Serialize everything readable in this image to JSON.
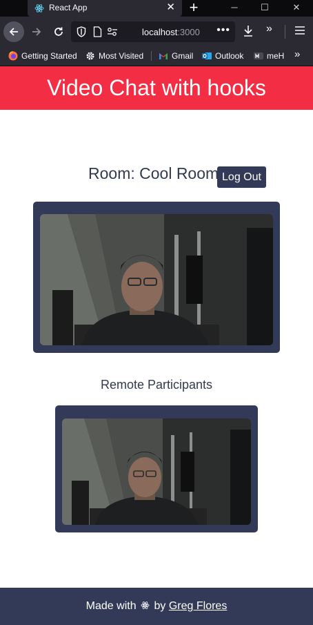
{
  "browser": {
    "tab_title": "React App",
    "url_host": "localhost",
    "url_port": ":3000",
    "bookmarks": [
      {
        "label": "Getting Started",
        "icon": "firefox-icon"
      },
      {
        "label": "Most Visited",
        "icon": "gear-icon"
      },
      {
        "label": "Gmail",
        "icon": "gmail-icon"
      },
      {
        "label": "Outlook",
        "icon": "outlook-icon"
      },
      {
        "label": "meH",
        "icon": "meh-icon"
      }
    ]
  },
  "app": {
    "header_title": "Video Chat with hooks",
    "room_title": "Room: Cool Room",
    "logout_label": "Log Out",
    "remote_heading": "Remote Participants",
    "footer": {
      "made_with": "Made with",
      "by": "by",
      "author": "Greg Flores"
    }
  },
  "colors": {
    "header_bg": "#f22d44",
    "navy": "#323a57"
  }
}
